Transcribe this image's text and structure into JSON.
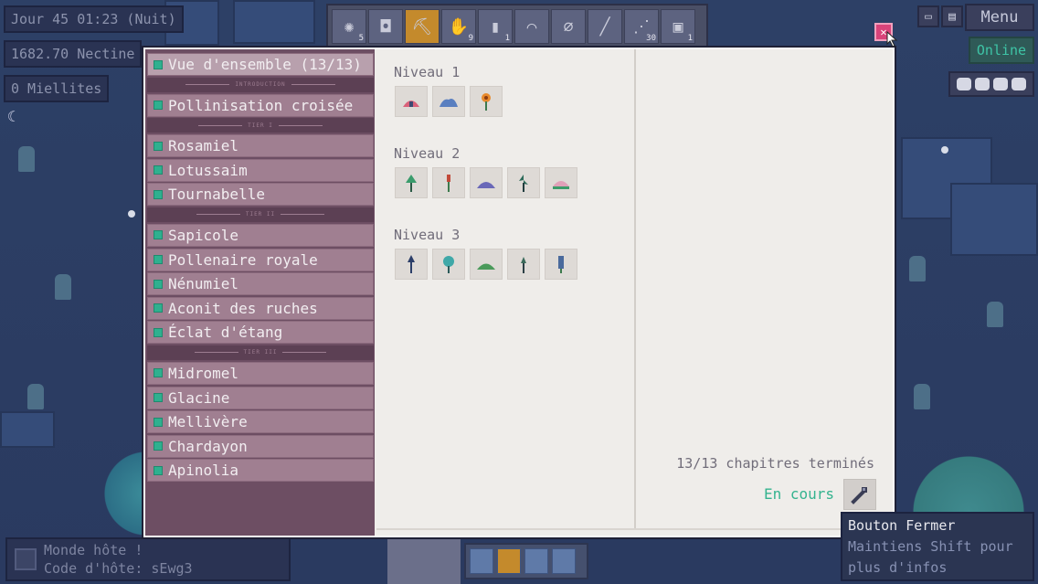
{
  "hud": {
    "day_time": "Jour 45 01:23 (Nuit)",
    "currency": "1682.70 Nectine",
    "honey": "0 Miellites"
  },
  "toolbar": {
    "slots": [
      {
        "icon": "seed-bag-icon",
        "count": "5"
      },
      {
        "icon": "pot-icon",
        "count": ""
      },
      {
        "icon": "pickaxe-icon",
        "count": ""
      },
      {
        "icon": "glove-icon",
        "count": "9"
      },
      {
        "icon": "jar-icon",
        "count": "1"
      },
      {
        "icon": "scythe-icon",
        "count": ""
      },
      {
        "icon": "net-icon",
        "count": ""
      },
      {
        "icon": "knife-icon",
        "count": ""
      },
      {
        "icon": "branch-icon",
        "count": "30"
      },
      {
        "icon": "crate-icon",
        "count": "1"
      }
    ]
  },
  "top_right": {
    "menu_label": "Menu",
    "online_label": "Online"
  },
  "host": {
    "line1": "Monde hôte !",
    "line2": "Code d'hôte: sEwg3"
  },
  "sidebar": {
    "overview": "Vue d'ensemble (13/13)",
    "tier_labels": [
      "Introduction",
      "Tier I",
      "Tier II",
      "Tier III"
    ],
    "intro_items": [
      "Pollinisation croisée"
    ],
    "tier1_items": [
      "Rosamiel",
      "Lotussaim",
      "Tournabelle"
    ],
    "tier2_items": [
      "Sapicole",
      "Pollenaire royale",
      "Nénumiel",
      "Aconit des ruches",
      "Éclat d'étang"
    ],
    "tier3_items": [
      "Midromel",
      "Glacine",
      "Mellivère",
      "Chardayon",
      "Apinolia"
    ]
  },
  "levels": [
    {
      "title": "Niveau 1",
      "plants": [
        "pink-mushroom-icon",
        "blue-mound-icon",
        "orange-flower-icon"
      ]
    },
    {
      "title": "Niveau 2",
      "plants": [
        "green-sprout-icon",
        "red-stalk-icon",
        "purple-mound-icon",
        "dark-sprout-icon",
        "water-lily-icon"
      ]
    },
    {
      "title": "Niveau 3",
      "plants": [
        "navy-sprout-icon",
        "teal-bulb-icon",
        "green-mound-icon",
        "small-sprout-icon",
        "blue-stalk-icon"
      ]
    }
  ],
  "summary": {
    "chapters": "13/13 chapitres terminés",
    "status": "En cours",
    "status_color": "#34b38f"
  },
  "tooltip": {
    "title": "Bouton Fermer",
    "hint_line1": "Maintiens Shift pour",
    "hint_line2": "plus d'infos"
  },
  "colors": {
    "accent": "#2fb08f",
    "sidebar": "#6d4e63",
    "close": "#d9437a"
  }
}
